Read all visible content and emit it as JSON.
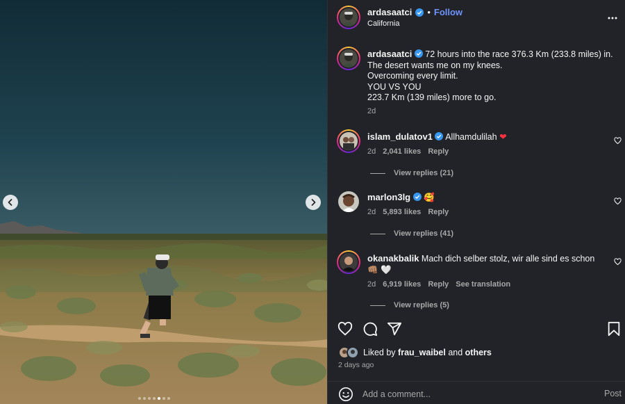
{
  "post": {
    "username": "ardasaatci",
    "follow_label": "Follow",
    "location": "California",
    "caption": {
      "username": "ardasaatci",
      "lines": [
        "72 hours into the race 376.3 Km (233.8 miles) in.",
        "The desert wants me on my knees.",
        "Overcoming every limit.",
        "YOU VS YOU",
        "223.7 Km (139 miles) more to go."
      ],
      "time": "2d"
    }
  },
  "comments": [
    {
      "username": "islam_dulatov1",
      "text": "Allhamdulilah",
      "emoji": "❤",
      "time": "2d",
      "likes": "2,041 likes",
      "reply_label": "Reply",
      "view_replies": "View replies (21)"
    },
    {
      "username": "marlon3lg",
      "text": "",
      "emoji": "🥰",
      "time": "2d",
      "likes": "5,893 likes",
      "reply_label": "Reply",
      "view_replies": "View replies (41)"
    },
    {
      "username": "okanakbalik",
      "text": "Mach dich selber stolz, wir alle sind es schon",
      "emoji": "👊🏽",
      "emoji2": "🤍",
      "time": "2d",
      "likes": "6,919 likes",
      "reply_label": "Reply",
      "translate_label": "See translation",
      "view_replies": "View replies (5)"
    }
  ],
  "liked_by": {
    "prefix": "Liked by",
    "user": "frau_waibel",
    "and": "and",
    "others": "others"
  },
  "posted_ago": "2 days ago",
  "add_comment": {
    "placeholder": "Add a comment...",
    "post_label": "Post"
  },
  "carousel": {
    "total_slides": 7,
    "active_slide": 4
  },
  "colors": {
    "panel_bg": "#212328",
    "accent_link": "#6f93ff",
    "muted_text": "#a8a8a8",
    "verified_blue": "#3897f0"
  },
  "icons": [
    "verified-badge-icon",
    "more-options-icon",
    "heart-icon",
    "comment-icon",
    "share-icon",
    "bookmark-icon",
    "emoji-icon",
    "chevron-left-icon",
    "chevron-right-icon"
  ]
}
